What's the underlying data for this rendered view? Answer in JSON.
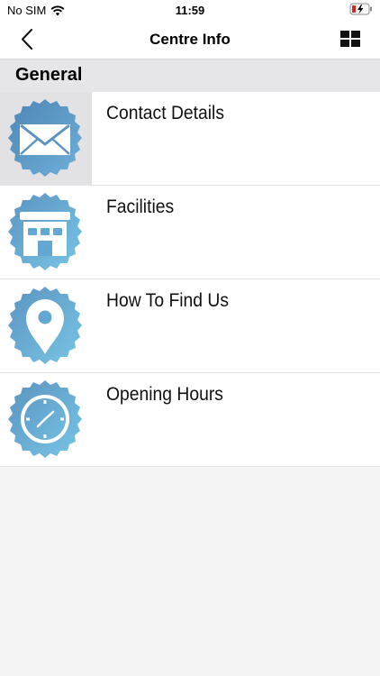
{
  "status_bar": {
    "carrier": "No SIM",
    "time": "11:59"
  },
  "nav": {
    "title": "Centre Info"
  },
  "section": {
    "title": "General"
  },
  "menu": {
    "items": [
      {
        "label": "Contact Details",
        "icon": "envelope-icon"
      },
      {
        "label": "Facilities",
        "icon": "building-icon"
      },
      {
        "label": "How To Find Us",
        "icon": "map-pin-icon"
      },
      {
        "label": "Opening Hours",
        "icon": "clock-icon"
      }
    ]
  },
  "colors": {
    "badge_dark": "#5b95c2",
    "badge_light": "#74c2e4",
    "accent_icon": "#ffffff"
  }
}
